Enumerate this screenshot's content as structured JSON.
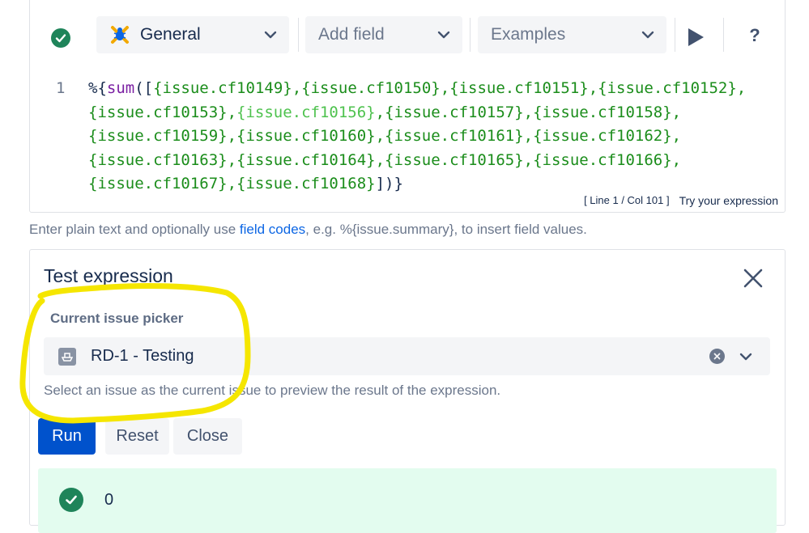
{
  "toolbar": {
    "status_icon": "check-circle-icon",
    "parser_select": "General",
    "add_field_select": "Add field",
    "examples_select": "Examples",
    "run_icon": "play-icon",
    "help_label": "?"
  },
  "editor": {
    "line_number": "1",
    "code": {
      "prefix": "%{",
      "fn": "sum",
      "open": "([",
      "part1": "{issue.cf10149},{issue.cf10150},{issue.cf10151},{issue.cf10152},\n{issue.cf10153},",
      "highlighted": "{issue.cf10156}",
      "part2": ",{issue.cf10157},{issue.cf10158},\n{issue.cf10159},{issue.cf10160},{issue.cf10161},{issue.cf10162},\n{issue.cf10163},{issue.cf10164},{issue.cf10165},{issue.cf10166},\n{issue.cf10167},{issue.cf10168}",
      "close": "])}"
    },
    "cursor_position": "[ Line 1 / Col 101 ]",
    "try_link": "Try your expression"
  },
  "hint": {
    "before": "Enter plain text and optionally use ",
    "link": "field codes",
    "after": ", e.g. %{issue.summary}, to insert field values."
  },
  "test_panel": {
    "title": "Test expression",
    "picker_label": "Current issue picker",
    "picker_value": "RD-1 - Testing",
    "helper_text": "Select an issue as the current issue to preview the result of the expression.",
    "buttons": {
      "run": "Run",
      "reset": "Reset",
      "close": "Close"
    },
    "result_value": "0"
  },
  "colors": {
    "success": "#1f845a",
    "primary": "#0052cc",
    "code_green": "#1b8d1b",
    "annotation": "#f5e600"
  }
}
